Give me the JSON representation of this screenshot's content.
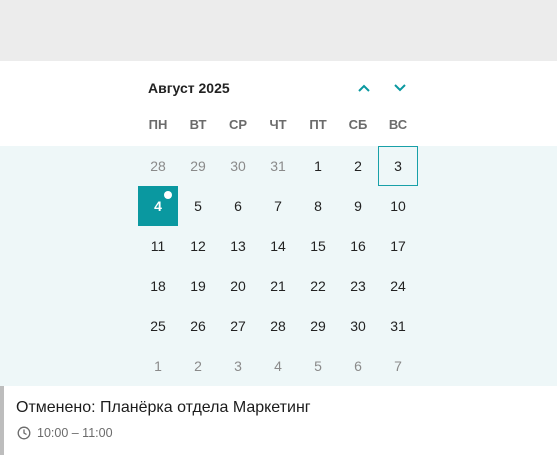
{
  "calendar": {
    "month_title": "Август 2025",
    "accent_color": "#0a98a0",
    "weekdays": [
      "ПН",
      "ВТ",
      "СР",
      "ЧТ",
      "ПТ",
      "СБ",
      "ВС"
    ],
    "weeks": [
      [
        "28",
        "29",
        "30",
        "31",
        "1",
        "2",
        "3"
      ],
      [
        "4",
        "5",
        "6",
        "7",
        "8",
        "9",
        "10"
      ],
      [
        "11",
        "12",
        "13",
        "14",
        "15",
        "16",
        "17"
      ],
      [
        "18",
        "19",
        "20",
        "21",
        "22",
        "23",
        "24"
      ],
      [
        "25",
        "26",
        "27",
        "28",
        "29",
        "30",
        "31"
      ],
      [
        "1",
        "2",
        "3",
        "4",
        "5",
        "6",
        "7"
      ]
    ],
    "today": "4",
    "outlined_day": "3"
  },
  "event": {
    "title": "Отменено: Планёрка отдела Маркетинг",
    "time": "10:00 – 11:00",
    "icon": "clock-icon"
  }
}
